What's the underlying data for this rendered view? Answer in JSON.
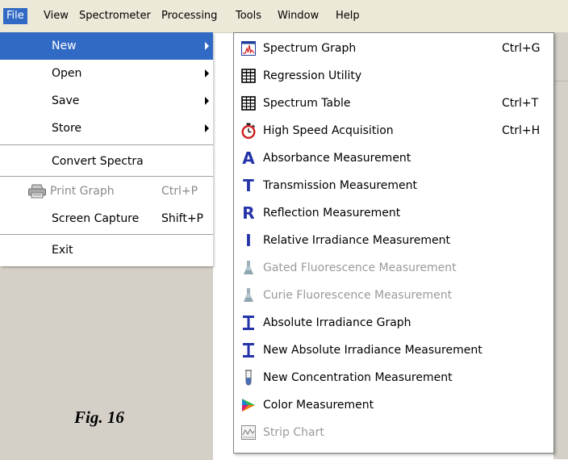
{
  "menubar": {
    "items": [
      {
        "label": "File",
        "active": true
      },
      {
        "label": "View"
      },
      {
        "label": "Spectrometer"
      },
      {
        "label": "Processing"
      },
      {
        "label": "Tools"
      },
      {
        "label": "Window"
      },
      {
        "label": "Help"
      }
    ]
  },
  "file_menu": {
    "items": [
      {
        "label": "New",
        "submenu": true,
        "active": true
      },
      {
        "label": "Open",
        "submenu": true
      },
      {
        "label": "Save",
        "submenu": true
      },
      {
        "label": "Store",
        "submenu": true
      },
      {
        "label": "Convert Spectra"
      },
      {
        "label": "Print Graph",
        "shortcut": "Ctrl+P",
        "disabled": true,
        "icon": "printer-icon"
      },
      {
        "label": "Screen Capture",
        "shortcut": "Shift+P"
      },
      {
        "label": "Exit"
      }
    ]
  },
  "new_menu": {
    "items": [
      {
        "label": "Spectrum Graph",
        "shortcut": "Ctrl+G",
        "icon": "spectrum-graph-icon"
      },
      {
        "label": "Regression Utility",
        "icon": "table-grid-icon"
      },
      {
        "label": "Spectrum Table",
        "shortcut": "Ctrl+T",
        "icon": "table-grid-icon"
      },
      {
        "label": "High Speed Acquisition",
        "shortcut": "Ctrl+H",
        "icon": "stopwatch-icon"
      },
      {
        "label": "Absorbance Measurement",
        "icon": "letter-a-icon",
        "glyph": "A"
      },
      {
        "label": "Transmission Measurement",
        "icon": "letter-t-icon",
        "glyph": "T"
      },
      {
        "label": "Reflection Measurement",
        "icon": "letter-r-icon",
        "glyph": "R"
      },
      {
        "label": "Relative Irradiance Measurement",
        "icon": "letter-i-icon",
        "glyph": "I"
      },
      {
        "label": "Gated Fluorescence Measurement",
        "icon": "flask-icon",
        "disabled": true
      },
      {
        "label": "Curie Fluorescence Measurement",
        "icon": "flask-icon",
        "disabled": true
      },
      {
        "label": "Absolute Irradiance Graph",
        "icon": "serif-i-icon"
      },
      {
        "label": "New Absolute Irradiance Measurement",
        "icon": "serif-i-icon"
      },
      {
        "label": "New Concentration Measurement",
        "icon": "test-tube-icon"
      },
      {
        "label": "Color Measurement",
        "icon": "color-wheel-icon"
      },
      {
        "label": "Strip Chart",
        "icon": "strip-chart-icon",
        "disabled": true
      }
    ]
  },
  "caption": "Fig. 16",
  "colors": {
    "menu_highlight": "#316ac5",
    "menubar_bg": "#ece9d8",
    "letter_icon_blue": "#2433a8",
    "disabled_text": "#9a9a9a"
  }
}
